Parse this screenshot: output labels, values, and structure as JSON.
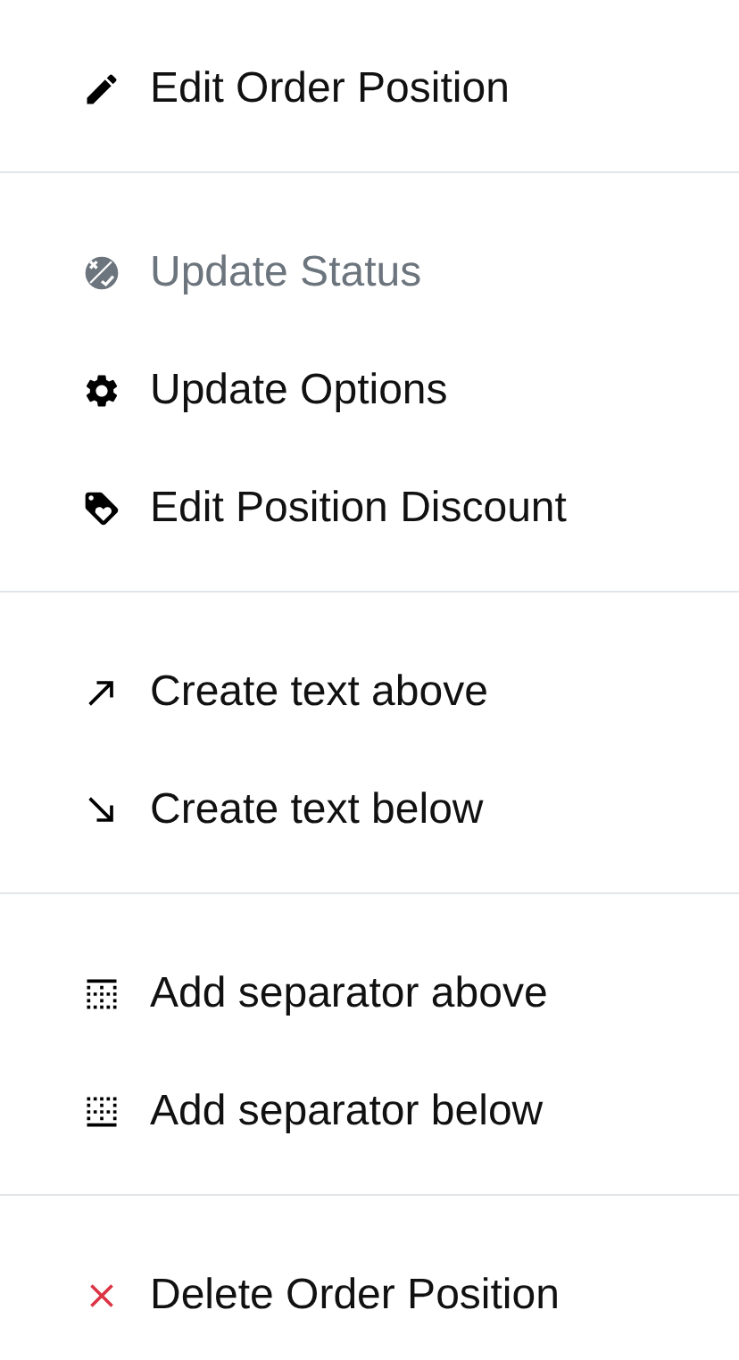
{
  "menu": {
    "groups": [
      {
        "items": [
          {
            "label": "Edit Order Position",
            "kind": "edit",
            "disabled": false
          }
        ]
      },
      {
        "items": [
          {
            "label": "Update Status",
            "kind": "status",
            "disabled": true
          },
          {
            "label": "Update Options",
            "kind": "options",
            "disabled": false
          },
          {
            "label": "Edit Position Discount",
            "kind": "discount",
            "disabled": false
          }
        ]
      },
      {
        "items": [
          {
            "label": "Create text above",
            "kind": "text-above",
            "disabled": false
          },
          {
            "label": "Create text below",
            "kind": "text-below",
            "disabled": false
          }
        ]
      },
      {
        "items": [
          {
            "label": "Add separator above",
            "kind": "separator-above",
            "disabled": false
          },
          {
            "label": "Add separator below",
            "kind": "separator-below",
            "disabled": false
          }
        ]
      },
      {
        "items": [
          {
            "label": "Delete Order Position",
            "kind": "delete",
            "disabled": false
          }
        ]
      }
    ]
  }
}
